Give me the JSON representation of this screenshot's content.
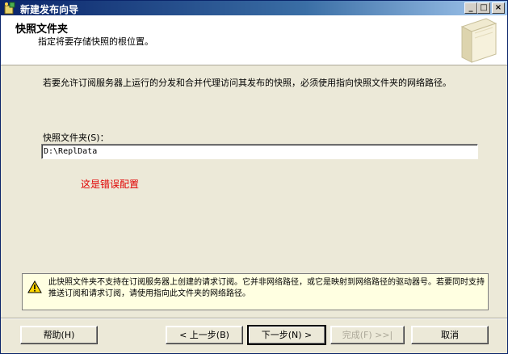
{
  "window": {
    "title": "新建发布向导",
    "controls": {
      "minimize": "_",
      "maximize": "□",
      "close": "×"
    }
  },
  "header": {
    "title": "快照文件夹",
    "subtitle": "指定将要存储快照的根位置。"
  },
  "main": {
    "instruction": "若要允许订阅服务器上运行的分发和合并代理访问其发布的快照，必须使用指向快照文件夹的网络路径。",
    "folder_label": "快照文件夹(S)：",
    "folder_value": "D:\\ReplData",
    "error_note": "这是错误配置"
  },
  "warning": {
    "text": "此快照文件夹不支持在订阅服务器上创建的请求订阅。它并非网络路径，或它是映射到网络路径的驱动器号。若要同时支持推送订阅和请求订阅，请使用指向此文件夹的网络路径。"
  },
  "buttons": {
    "help": "帮助(H)",
    "back": "< 上一步(B)",
    "next": "下一步(N) >",
    "finish": "完成(F) >>|",
    "cancel": "取消"
  },
  "colors": {
    "error": "#e00000",
    "warning_bg": "#ffffe1",
    "titlebar": "#0a246a"
  }
}
